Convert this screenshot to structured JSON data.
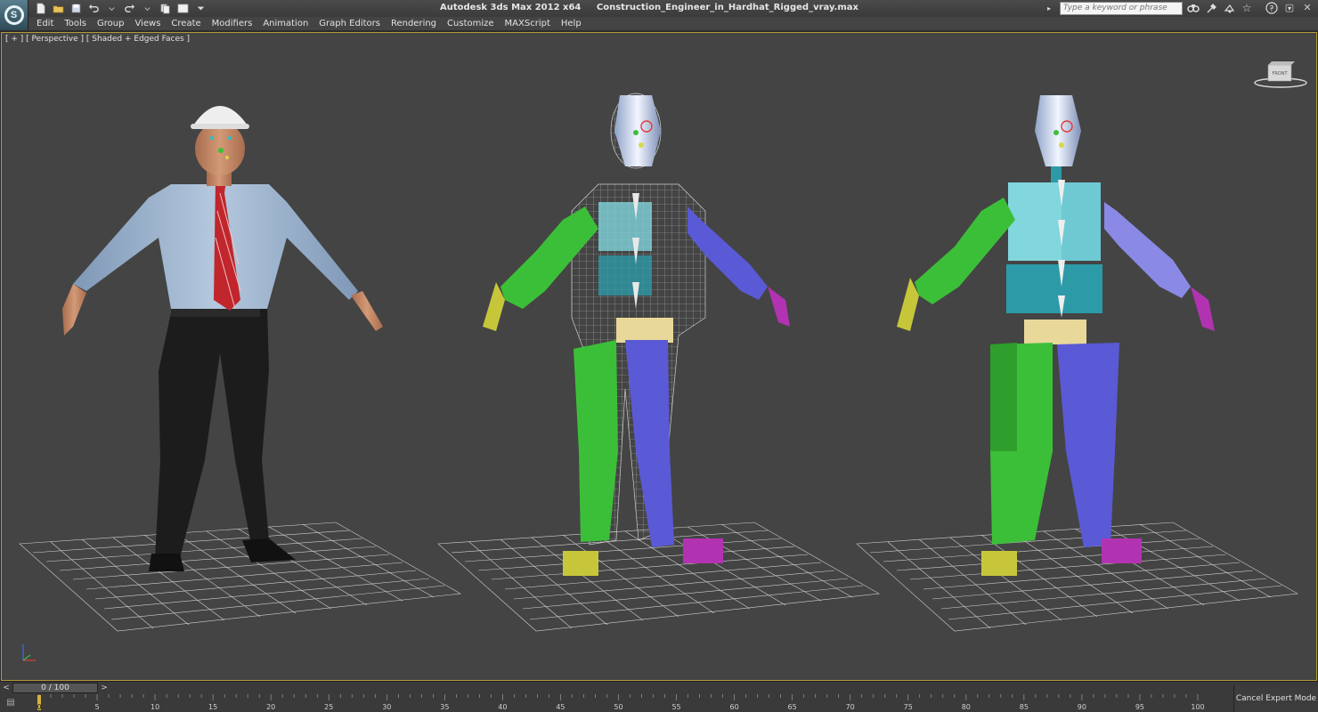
{
  "window": {
    "app_title": "Autodesk 3ds Max  2012 x64",
    "file_title": "Construction_Engineer_in_Hardhat_Rigged_vray.max",
    "search_placeholder": "Type a keyword or phrase",
    "logo_letter": "S"
  },
  "menu": {
    "items": [
      "Edit",
      "Tools",
      "Group",
      "Views",
      "Create",
      "Modifiers",
      "Animation",
      "Graph Editors",
      "Rendering",
      "Customize",
      "MAXScript",
      "Help"
    ]
  },
  "viewport": {
    "label": "[ + ] [ Perspective ] [ Shaded + Edged Faces ]",
    "viewcube_label": "FRONT"
  },
  "timeline": {
    "prev": "<",
    "slider_label": "0 / 100",
    "next": ">",
    "ticks": [
      "0",
      "5",
      "10",
      "15",
      "20",
      "25",
      "30",
      "35",
      "40",
      "45",
      "50",
      "55",
      "60",
      "65",
      "70",
      "75",
      "80",
      "85",
      "90",
      "95",
      "100"
    ]
  },
  "status": {
    "cancel_expert_mode": "Cancel Expert Mode"
  },
  "colors": {
    "viewport_bg": "#444444",
    "active_border": "#b49a3a",
    "shirt": "#9fb7d3",
    "tie": "#c0262c",
    "pants": "#1c1c1c",
    "biped_green": "#3cbf38",
    "biped_blue": "#5a5ad6",
    "biped_teal": "#2d9aa8",
    "biped_yellow": "#c7c63a",
    "biped_magenta": "#b233b2",
    "pelvis_beige": "#e8d89a"
  },
  "icons": [
    "new-file-icon",
    "open-file-icon",
    "save-icon",
    "undo-icon",
    "redo-icon",
    "project-folder-icon",
    "binoculars-icon",
    "tools-icon",
    "community-icon",
    "favorites-icon",
    "help-icon"
  ]
}
